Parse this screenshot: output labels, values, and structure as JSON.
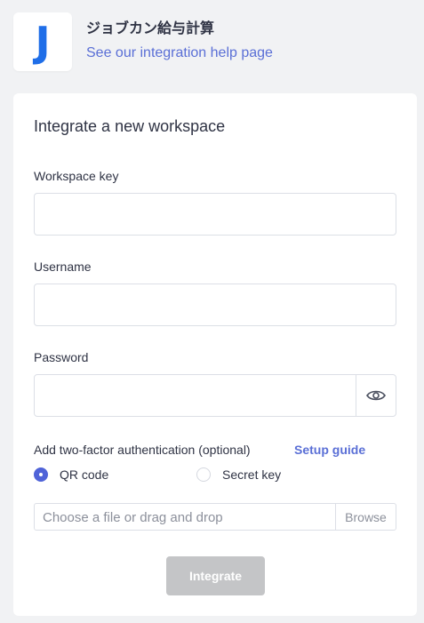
{
  "header": {
    "logo_letter": "J",
    "app_name": "ジョブカン給与計算",
    "help_link": "See our integration help page"
  },
  "form": {
    "title": "Integrate a new workspace",
    "workspace_key": {
      "label": "Workspace key",
      "value": ""
    },
    "username": {
      "label": "Username",
      "value": ""
    },
    "password": {
      "label": "Password",
      "value": "",
      "toggle_icon": "eye-icon"
    },
    "two_factor": {
      "label": "Add two-factor authentication (optional)",
      "setup_guide": "Setup guide",
      "options": [
        {
          "label": "QR code",
          "selected": true
        },
        {
          "label": "Secret key",
          "selected": false
        }
      ]
    },
    "file": {
      "placeholder": "Choose a file or drag and drop",
      "browse_label": "Browse"
    },
    "submit_label": "Integrate"
  },
  "colors": {
    "accent": "#5a6fd6",
    "radio_selected": "#4f63d8",
    "logo_blue": "#1f6ee8",
    "button_disabled": "#c4c5c7",
    "background": "#f1f2f4"
  }
}
